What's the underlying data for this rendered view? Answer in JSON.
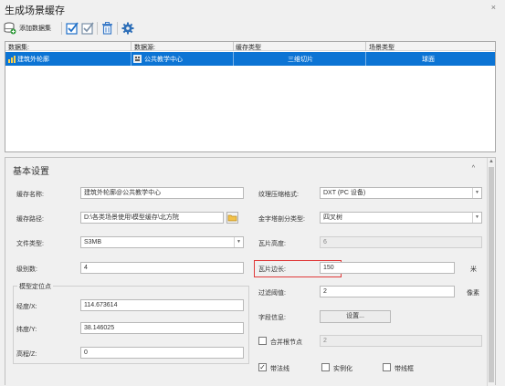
{
  "window": {
    "title": "生成场景缓存",
    "close_label": "×"
  },
  "toolbar": {
    "add_dataset_label": "添加数据集"
  },
  "grid": {
    "columns": [
      "数据集:",
      "数据源:",
      "缓存类型",
      "场景类型"
    ],
    "rows": [
      {
        "dataset": "建筑外轮廓",
        "datasource": "公共教学中心",
        "cache_type": "三维切片",
        "scene_type": "球面"
      }
    ]
  },
  "settings": {
    "title": "基本设置",
    "collapse_icon": "^",
    "cache_name": {
      "label": "缓存名称:",
      "value": "建筑外轮廓@公共教学中心"
    },
    "cache_path": {
      "label": "缓存路径:",
      "value": "D:\\各类场景使用\\模型缓存\\北方院"
    },
    "file_type": {
      "label": "文件类型:",
      "value": "S3MB"
    },
    "level": {
      "label": "级别数:",
      "value": "4"
    },
    "model_position": {
      "legend": "模型定位点",
      "longitude": {
        "label": "经度/X:",
        "value": "114.673614"
      },
      "latitude": {
        "label": "纬度/Y:",
        "value": "38.146025"
      },
      "elevation": {
        "label": "高程/Z:",
        "value": "0"
      }
    },
    "texture_compression": {
      "label": "纹理压缩格式:",
      "value": "DXT (PC 设备)"
    },
    "pyramid_split": {
      "label": "金字塔剖分类型:",
      "value": "四叉树"
    },
    "tile_height": {
      "label": "瓦片高度:",
      "value": "6"
    },
    "tile_side": {
      "label": "瓦片边长:",
      "value": "150",
      "unit": "米"
    },
    "filter_threshold": {
      "label": "过滤阈值:",
      "value": "2",
      "unit": "像素"
    },
    "field_info": {
      "label": "字段信息:",
      "button": "设置..."
    },
    "merge_root": {
      "label": "合并根节点",
      "value": "2",
      "checked": false
    },
    "with_normals": {
      "label": "带法线",
      "checked": true
    },
    "instancing": {
      "label": "实例化",
      "checked": false
    },
    "with_wireframe": {
      "label": "带线框",
      "checked": false
    }
  },
  "colors": {
    "selection": "#0c74d4",
    "highlight": "#e03a3a",
    "accent": "#1e6fc8"
  }
}
